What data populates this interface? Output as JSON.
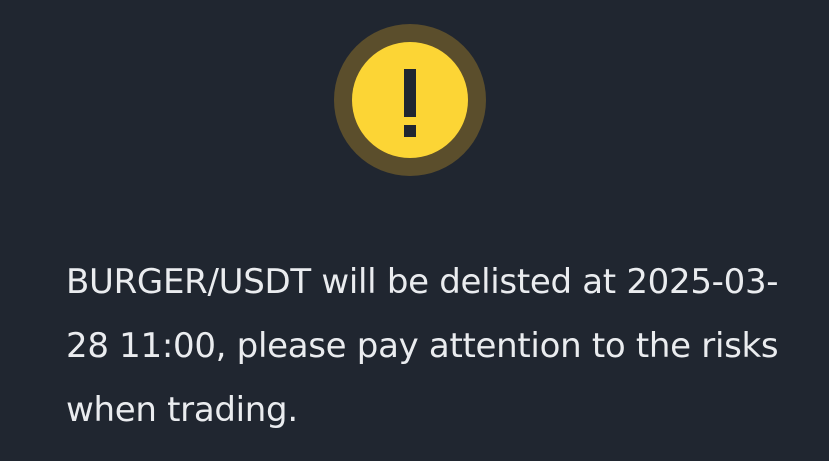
{
  "notice": {
    "icon": "warning-exclamation-icon",
    "accent_color": "#FCD535",
    "ring_color": "#5B4E2C",
    "background_color": "#202630",
    "message": "BURGER/USDT will be delisted at 2025-03-28 11:00, please pay attention to the risks when trading."
  }
}
